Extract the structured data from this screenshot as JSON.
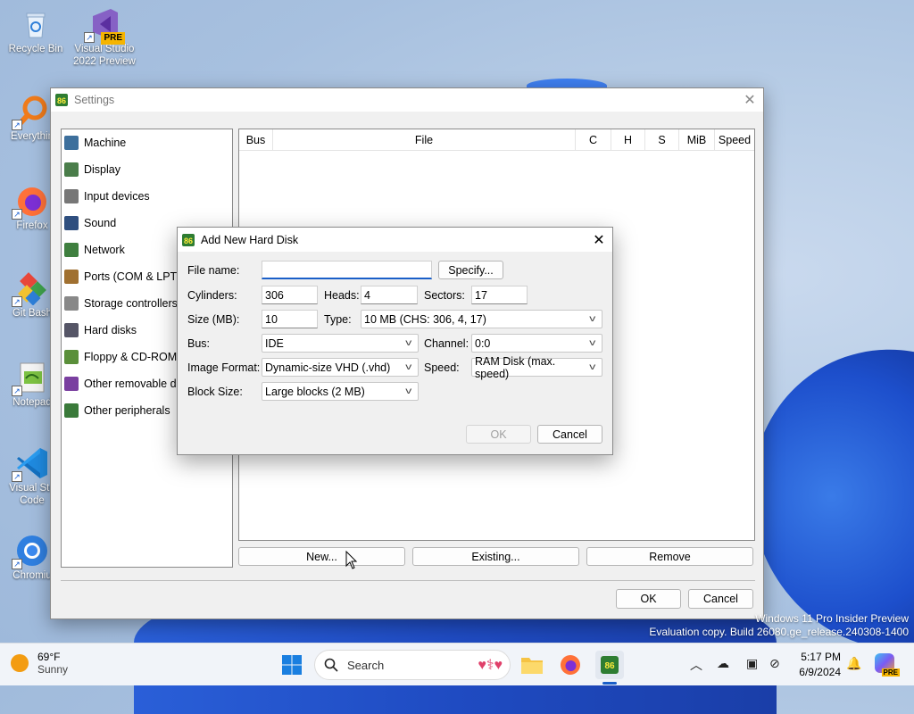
{
  "desktop": {
    "icons": [
      {
        "label": "Recycle Bin"
      },
      {
        "label": "Visual Studio 2022 Preview",
        "badge": "PRE"
      },
      {
        "label": "Everythin"
      },
      {
        "label": "Firefox"
      },
      {
        "label": "Git Bash"
      },
      {
        "label": "Notepad"
      },
      {
        "label": "Visual Stu Code"
      },
      {
        "label": "Chromiu"
      }
    ],
    "watermark": {
      "line1": "Windows 11 Pro Insider Preview",
      "line2": "Evaluation copy. Build 26080.ge_release.240308-1400"
    }
  },
  "settings_window": {
    "title": "Settings",
    "nav_items": [
      {
        "label": "Machine",
        "icon": "machine-icon"
      },
      {
        "label": "Display",
        "icon": "display-icon"
      },
      {
        "label": "Input devices",
        "icon": "input-devices-icon"
      },
      {
        "label": "Sound",
        "icon": "sound-icon"
      },
      {
        "label": "Network",
        "icon": "network-icon"
      },
      {
        "label": "Ports (COM & LPT)",
        "icon": "ports-icon"
      },
      {
        "label": "Storage controllers",
        "icon": "storage-icon"
      },
      {
        "label": "Hard disks",
        "icon": "hard-disk-icon"
      },
      {
        "label": "Floppy & CD-ROM d",
        "icon": "floppy-icon"
      },
      {
        "label": "Other removable de",
        "icon": "removable-icon"
      },
      {
        "label": "Other peripherals",
        "icon": "peripherals-icon"
      }
    ],
    "disk_table": {
      "columns": [
        "Bus",
        "File",
        "C",
        "H",
        "S",
        "MiB",
        "Speed"
      ],
      "rows": []
    },
    "buttons": {
      "new": "New...",
      "existing": "Existing...",
      "remove": "Remove",
      "ok": "OK",
      "cancel": "Cancel"
    }
  },
  "dialog": {
    "title": "Add New Hard Disk",
    "file_name_label": "File name:",
    "file_name_value": "",
    "specify_button": "Specify...",
    "cylinders_label": "Cylinders:",
    "cylinders_value": "306",
    "heads_label": "Heads:",
    "heads_value": "4",
    "sectors_label": "Sectors:",
    "sectors_value": "17",
    "size_label": "Size (MB):",
    "size_value": "10",
    "type_label": "Type:",
    "type_value": "10 MB (CHS: 306, 4, 17)",
    "bus_label": "Bus:",
    "bus_value": "IDE",
    "channel_label": "Channel:",
    "channel_value": "0:0",
    "image_format_label": "Image Format:",
    "image_format_value": "Dynamic-size VHD (.vhd)",
    "speed_label": "Speed:",
    "speed_value": "RAM Disk (max. speed)",
    "block_size_label": "Block Size:",
    "block_size_value": "Large blocks (2 MB)",
    "ok_button": "OK",
    "cancel_button": "Cancel"
  },
  "taskbar": {
    "weather_temp": "69°F",
    "weather_cond": "Sunny",
    "search_placeholder": "Search",
    "time": "5:17 PM",
    "date": "6/9/2024",
    "copilot_badge": "PRE"
  },
  "colors": {
    "accent": "#1a5fc8",
    "taskbar_bg": "#f1f4f9",
    "window_bg": "#f0f0f0"
  }
}
